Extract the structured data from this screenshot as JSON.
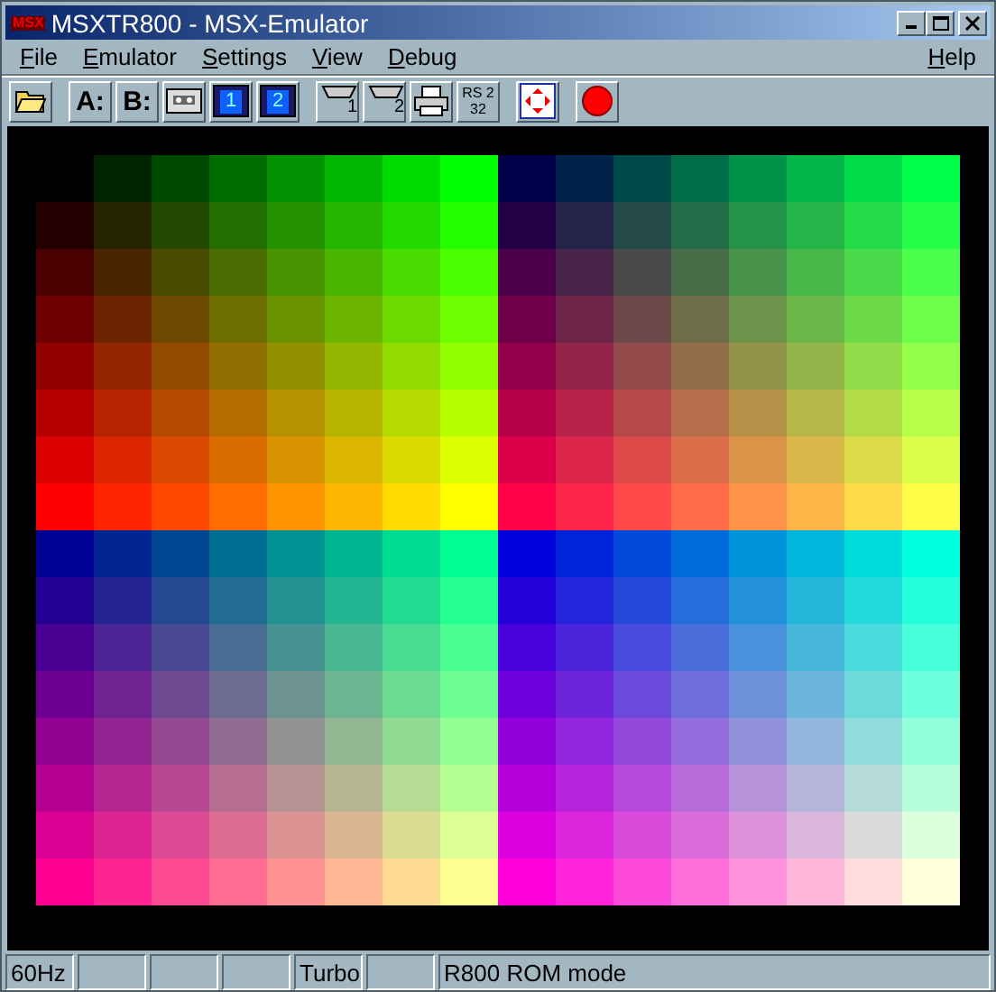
{
  "window": {
    "logo": "MSX",
    "title": "MSXTR800 - MSX-Emulator"
  },
  "menu": [
    {
      "label": "File"
    },
    {
      "label": "Emulator"
    },
    {
      "label": "Settings"
    },
    {
      "label": "View"
    },
    {
      "label": "Debug"
    },
    {
      "label": "Help"
    }
  ],
  "toolbar": [
    [
      {
        "kind": "folder"
      }
    ],
    [
      {
        "kind": "text",
        "label": "A:"
      },
      {
        "kind": "text",
        "label": "B:"
      },
      {
        "kind": "cassette"
      },
      {
        "kind": "disk",
        "label": "1"
      },
      {
        "kind": "disk",
        "label": "2"
      }
    ],
    [
      {
        "kind": "port",
        "label": "1"
      },
      {
        "kind": "port",
        "label": "2"
      },
      {
        "kind": "printer"
      },
      {
        "kind": "rs",
        "label": "RS 232"
      }
    ],
    [
      {
        "kind": "fullscreen"
      }
    ],
    [
      {
        "kind": "record"
      }
    ]
  ],
  "status_bar": [
    {
      "kind": "text",
      "text": "60Hz"
    },
    {
      "kind": "empty"
    },
    {
      "kind": "empty"
    },
    {
      "kind": "empty"
    },
    {
      "kind": "text",
      "text": "Turbo"
    },
    {
      "kind": "empty"
    },
    {
      "kind": "text",
      "text": "R800 ROM mode"
    }
  ]
}
